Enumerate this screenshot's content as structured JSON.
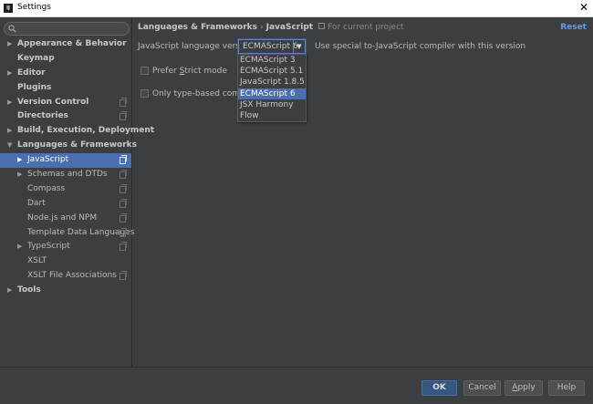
{
  "window": {
    "app_icon_text": "IJ",
    "title": "Settings",
    "close": "✕"
  },
  "sidebar": {
    "items": [
      {
        "label": "Appearance & Behavior",
        "level": 0,
        "arrow": "▶",
        "copy": false
      },
      {
        "label": "Keymap",
        "level": 0,
        "arrow": "",
        "copy": false
      },
      {
        "label": "Editor",
        "level": 0,
        "arrow": "▶",
        "copy": false
      },
      {
        "label": "Plugins",
        "level": 0,
        "arrow": "",
        "copy": false
      },
      {
        "label": "Version Control",
        "level": 0,
        "arrow": "▶",
        "copy": true
      },
      {
        "label": "Directories",
        "level": 0,
        "arrow": "",
        "copy": true
      },
      {
        "label": "Build, Execution, Deployment",
        "level": 0,
        "arrow": "▶",
        "copy": false
      },
      {
        "label": "Languages & Frameworks",
        "level": 0,
        "arrow": "▼",
        "copy": false
      },
      {
        "label": "JavaScript",
        "level": 1,
        "arrow": "▶",
        "copy": true,
        "selected": true
      },
      {
        "label": "Schemas and DTDs",
        "level": 1,
        "arrow": "▶",
        "copy": true
      },
      {
        "label": "Compass",
        "level": 1,
        "arrow": "",
        "copy": true
      },
      {
        "label": "Dart",
        "level": 1,
        "arrow": "",
        "copy": true
      },
      {
        "label": "Node.js and NPM",
        "level": 1,
        "arrow": "",
        "copy": true
      },
      {
        "label": "Template Data Languages",
        "level": 1,
        "arrow": "",
        "copy": true
      },
      {
        "label": "TypeScript",
        "level": 1,
        "arrow": "▶",
        "copy": true
      },
      {
        "label": "XSLT",
        "level": 1,
        "arrow": "",
        "copy": false
      },
      {
        "label": "XSLT File Associations",
        "level": 1,
        "arrow": "",
        "copy": true
      },
      {
        "label": "Tools",
        "level": 0,
        "arrow": "▶",
        "copy": false
      }
    ]
  },
  "breadcrumb": {
    "part1": "Languages & Frameworks",
    "separator": "›",
    "part2": "JavaScript",
    "scope": "For current project"
  },
  "reset_label": "Reset",
  "language": {
    "label": "JavaScript language version",
    "selected": "ECMAScript 6",
    "hint": "Use special to-JavaScript compiler with this version",
    "options": [
      "ECMAScript 3",
      "ECMAScript 5.1",
      "JavaScript 1.8.5",
      "ECMAScript 6",
      "JSX Harmony",
      "Flow"
    ],
    "selected_index": 3
  },
  "checkboxes": {
    "strict_pre": "Prefer ",
    "strict_mnemonic": "S",
    "strict_post": "trict mode",
    "typed": "Only type-based complet"
  },
  "buttons": {
    "ok": "OK",
    "cancel": "Cancel",
    "apply_mnemonic": "A",
    "apply_rest": "pply",
    "help": "Help"
  },
  "colors": {
    "accent": "#4b6eaf",
    "link": "#589df6",
    "background": "#3c3f41"
  }
}
